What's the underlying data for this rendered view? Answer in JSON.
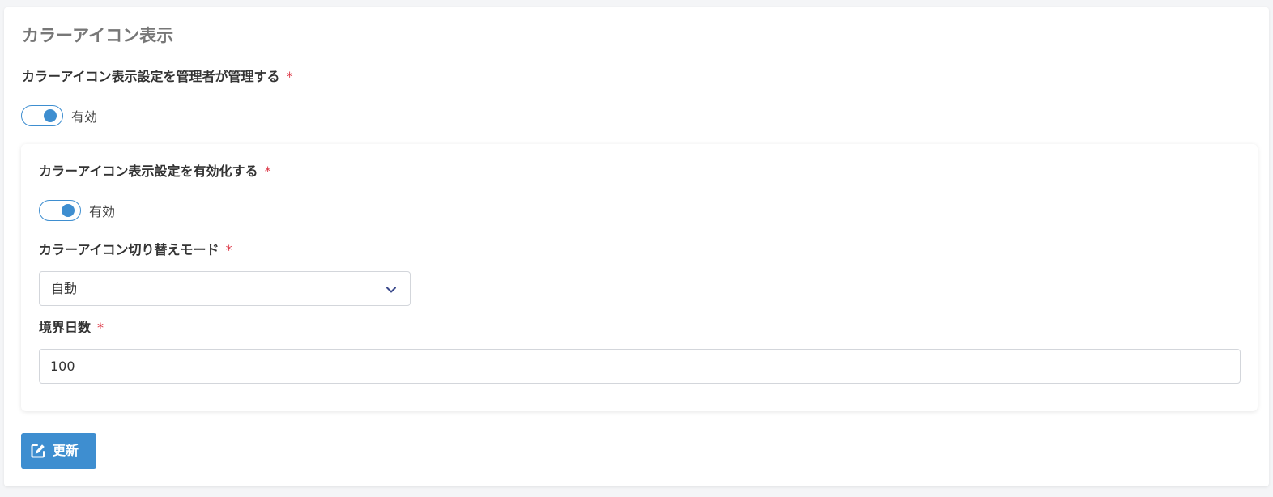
{
  "section": {
    "title": "カラーアイコン表示"
  },
  "admin_manage": {
    "label": "カラーアイコン表示設定を管理者が管理する",
    "required_mark": "*",
    "toggle_state_text": "有効",
    "enabled": true
  },
  "inner_settings": {
    "enable": {
      "label": "カラーアイコン表示設定を有効化する",
      "required_mark": "*",
      "toggle_state_text": "有効",
      "enabled": true
    },
    "mode": {
      "label": "カラーアイコン切り替えモード",
      "required_mark": "*",
      "selected_value": "自動"
    },
    "threshold_days": {
      "label": "境界日数",
      "required_mark": "*",
      "value": "100"
    }
  },
  "actions": {
    "update_label": "更新"
  },
  "colors": {
    "accent": "#3e8ed0",
    "required": "#dc3545",
    "section_title": "#777777"
  },
  "icons": {
    "chevron": "chevron-down-icon",
    "update": "edit-icon"
  }
}
